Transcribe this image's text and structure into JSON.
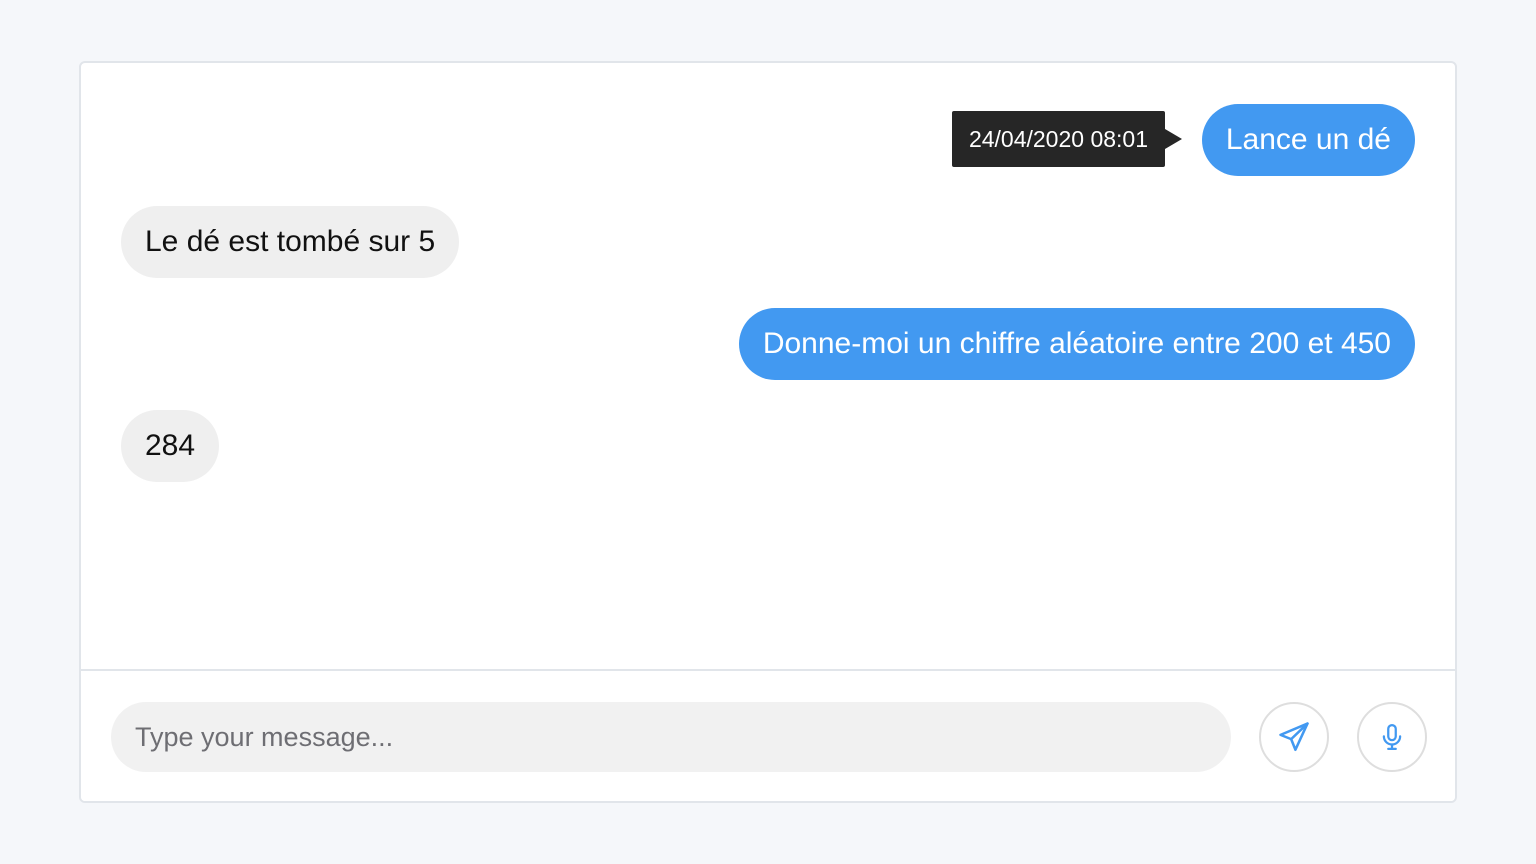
{
  "messages": [
    {
      "sender": "user",
      "text": "Lance un dé",
      "timestamp": "24/04/2020 08:01"
    },
    {
      "sender": "bot",
      "text": "Le dé est tombé sur 5"
    },
    {
      "sender": "user",
      "text": "Donne-moi un chiffre aléatoire entre 200 et 450"
    },
    {
      "sender": "bot",
      "text": "284"
    }
  ],
  "composer": {
    "placeholder": "Type your message...",
    "value": ""
  },
  "icons": {
    "send": "send-paper-plane-icon",
    "mic": "microphone-icon"
  },
  "colors": {
    "user_bubble": "#4299f1",
    "bot_bubble": "#efefef",
    "tooltip_bg": "#262626",
    "icon_accent": "#4299f1",
    "page_background": "#f5f7fa"
  }
}
